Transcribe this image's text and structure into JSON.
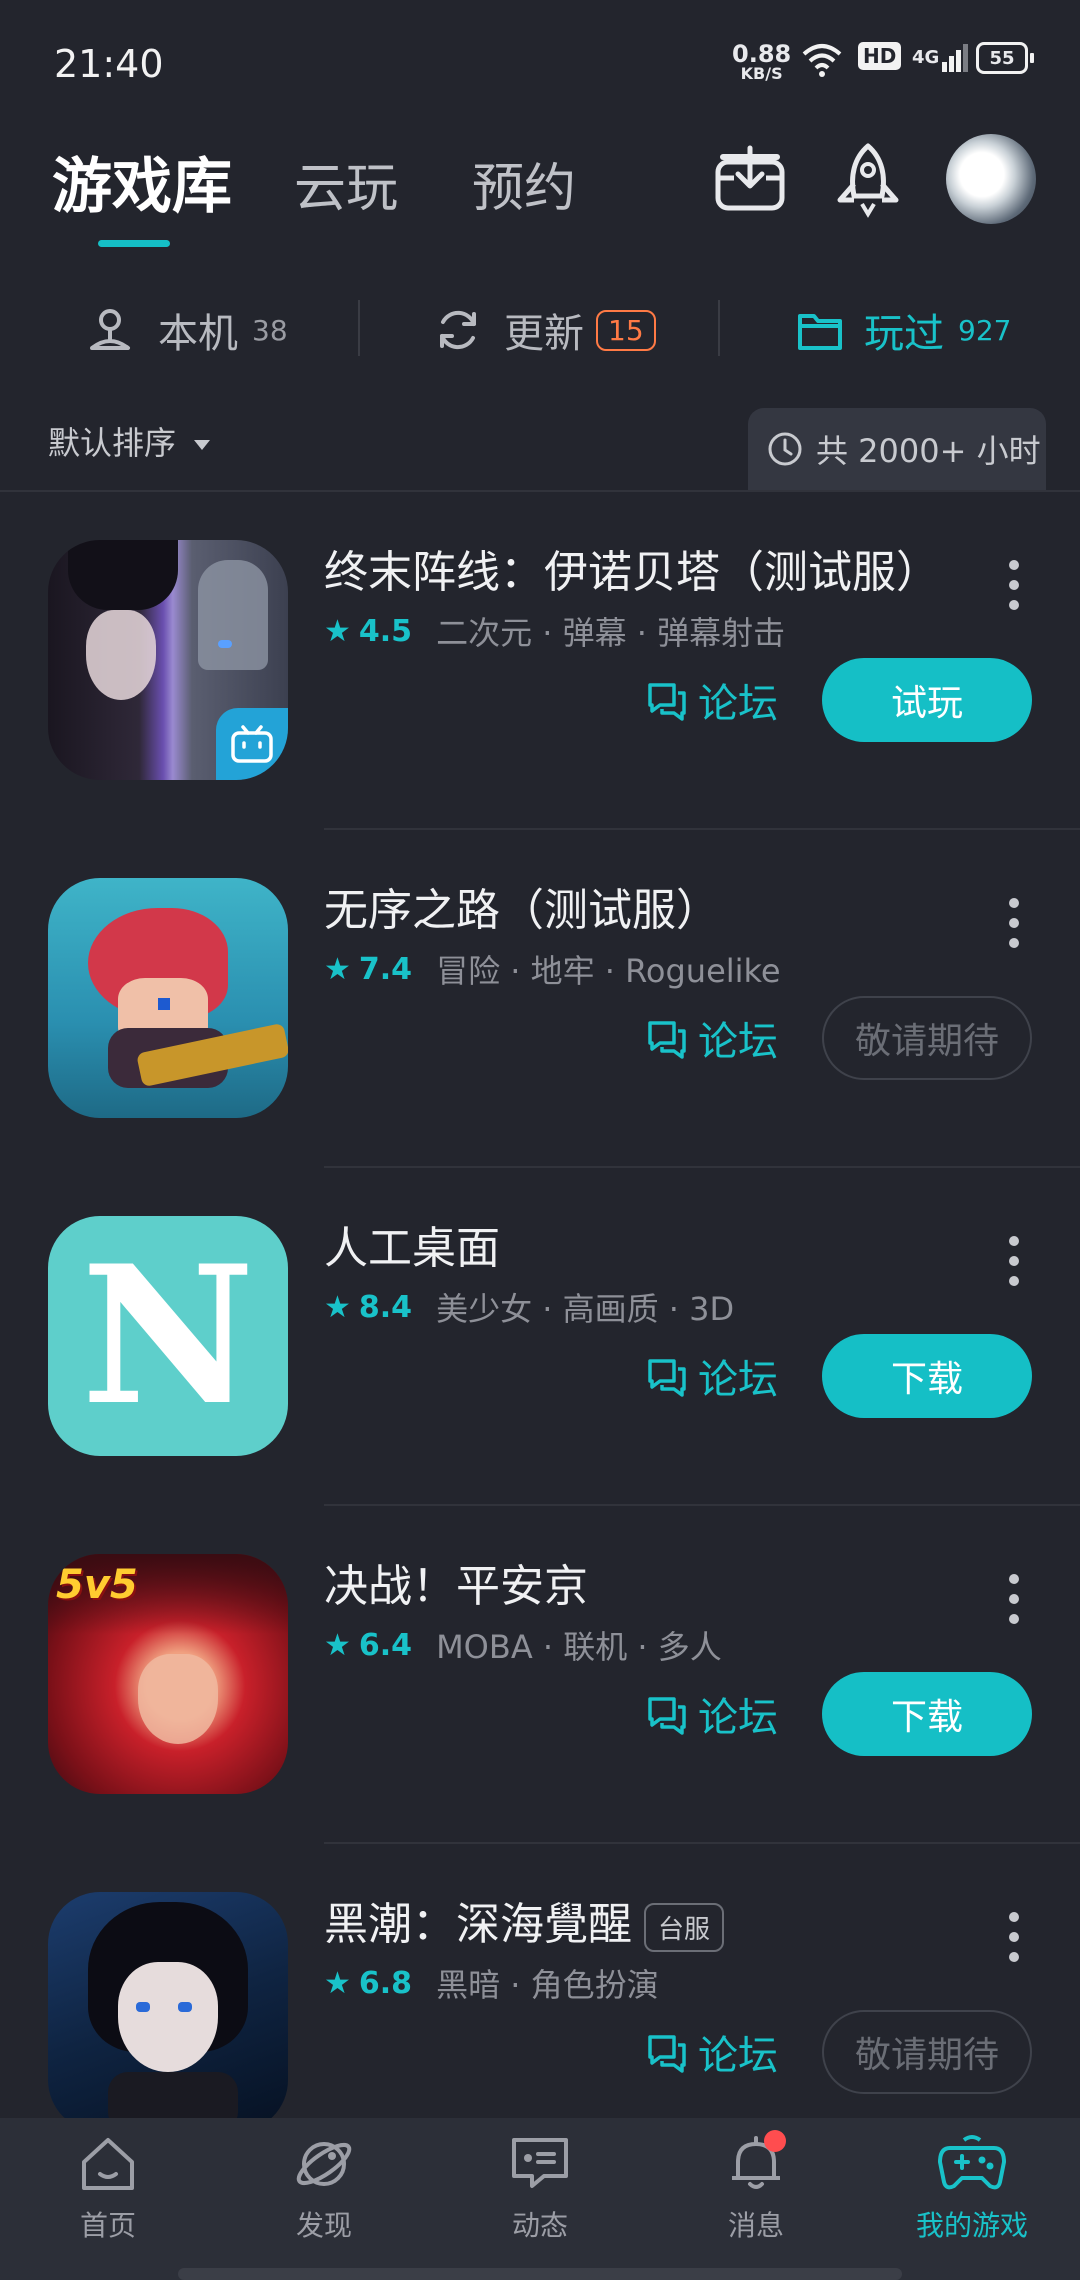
{
  "status_bar": {
    "time": "21:40",
    "net_speed_value": "0.88",
    "net_speed_unit": "KB/S",
    "hd_label": "HD",
    "network_label": "4G",
    "battery": "55"
  },
  "header": {
    "tabs": [
      {
        "label": "游戏库"
      },
      {
        "label": "云玩"
      },
      {
        "label": "预约"
      }
    ]
  },
  "filters": {
    "local_label": "本机",
    "local_count": "38",
    "update_label": "更新",
    "update_count": "15",
    "played_label": "玩过",
    "played_count": "927"
  },
  "sort": {
    "label": "默认排序",
    "hours": "共 2000+ 小时"
  },
  "games": [
    {
      "title": "终末阵线：伊诺贝塔（测试服）",
      "rating": "4.5",
      "tags": "二次元 · 弹幕 · 弹幕射击",
      "forum": "论坛",
      "action": "试玩",
      "action_style": "primary"
    },
    {
      "title": "无序之路（测试服）",
      "rating": "7.4",
      "tags": "冒险 · 地牢 · Roguelike",
      "forum": "论坛",
      "action": "敬请期待",
      "action_style": "muted"
    },
    {
      "title": "人工桌面",
      "rating": "8.4",
      "tags": "美少女 · 高画质 · 3D",
      "forum": "论坛",
      "action": "下载",
      "action_style": "primary",
      "icon_letter": "N"
    },
    {
      "title": "决战！平安京",
      "rating": "6.4",
      "tags": "MOBA · 联机 · 多人",
      "forum": "论坛",
      "action": "下载",
      "action_style": "primary",
      "icon_badge": "5v5"
    },
    {
      "title": "黑潮：深海覺醒",
      "title_tag": "台服",
      "rating": "6.8",
      "tags": "黑暗 · 角色扮演",
      "forum": "论坛",
      "action": "敬请期待",
      "action_style": "muted"
    }
  ],
  "bottom_nav": {
    "items": [
      {
        "label": "首页",
        "icon": "home-icon"
      },
      {
        "label": "发现",
        "icon": "planet-icon"
      },
      {
        "label": "动态",
        "icon": "chat-icon"
      },
      {
        "label": "消息",
        "icon": "bell-icon"
      },
      {
        "label": "我的游戏",
        "icon": "gamepad-icon"
      }
    ]
  },
  "colors": {
    "accent": "#19c2c9",
    "background": "#23252d",
    "badge_orange": "#ff7a45",
    "notification_red": "#ff4d4f"
  }
}
